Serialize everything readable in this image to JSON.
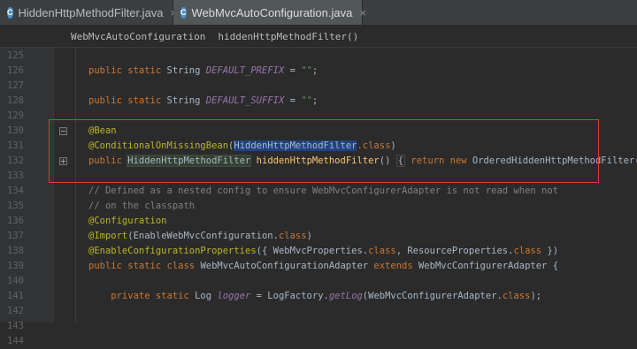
{
  "tabs": [
    {
      "icon": "C",
      "label": "HiddenHttpMethodFilter.java",
      "close": "×",
      "active": false
    },
    {
      "icon": "C",
      "label": "WebMvcAutoConfiguration.java",
      "close": "×",
      "active": true
    }
  ],
  "breadcrumb": {
    "class_name": "WebMvcAutoConfiguration",
    "method_name": "hiddenHttpMethodFilter()"
  },
  "lines": [
    {
      "n": "125",
      "parts": []
    },
    {
      "n": "126",
      "parts": [
        [
          "kw",
          "public static "
        ],
        [
          "cls",
          "String "
        ],
        [
          "const",
          "DEFAULT_PREFIX"
        ],
        [
          "cls",
          " = "
        ],
        [
          "str",
          "\"\""
        ],
        [
          "cls",
          ";"
        ]
      ]
    },
    {
      "n": "127",
      "parts": []
    },
    {
      "n": "128",
      "parts": [
        [
          "kw",
          "public static "
        ],
        [
          "cls",
          "String "
        ],
        [
          "const",
          "DEFAULT_SUFFIX"
        ],
        [
          "cls",
          " = "
        ],
        [
          "str",
          "\"\""
        ],
        [
          "cls",
          ";"
        ]
      ]
    },
    {
      "n": "129",
      "parts": []
    },
    {
      "n": "130",
      "parts": [
        [
          "ann",
          "@Bean"
        ]
      ]
    },
    {
      "n": "131",
      "parts": [
        [
          "ann",
          "@ConditionalOnMissingBean"
        ],
        [
          "cls",
          "("
        ],
        [
          "hl-sel",
          "HiddenHttpMethodFilter"
        ],
        [
          "kw",
          "."
        ],
        [
          "kw",
          "class"
        ],
        [
          "cls",
          ")"
        ]
      ]
    },
    {
      "n": "132",
      "parts": [
        [
          "kw",
          "public "
        ],
        [
          "hl-box",
          "HiddenHttpMethodFilter"
        ],
        [
          "cls",
          " "
        ],
        [
          "fn",
          "hiddenHttpMethodFilter"
        ],
        [
          "cls",
          "() "
        ],
        [
          "fold-inline",
          "{"
        ],
        [
          "kw",
          " return new "
        ],
        [
          "cls",
          "OrderedHiddenHttpMethodFilter(); "
        ],
        [
          "fold-inline",
          "}"
        ]
      ]
    },
    {
      "n": "133",
      "parts": []
    },
    {
      "n": "134",
      "parts": [
        [
          "cmt",
          "// Defined as a nested config to ensure WebMvcConfigurerAdapter is not read when not"
        ]
      ]
    },
    {
      "n": "135",
      "parts": [
        [
          "cmt",
          "// on the classpath"
        ]
      ]
    },
    {
      "n": "136",
      "parts": [
        [
          "ann",
          "@Configuration"
        ]
      ]
    },
    {
      "n": "137",
      "parts": [
        [
          "ann",
          "@Import"
        ],
        [
          "cls",
          "(EnableWebMvcConfiguration."
        ],
        [
          "kw",
          "class"
        ],
        [
          "cls",
          ")"
        ]
      ]
    },
    {
      "n": "138",
      "parts": [
        [
          "ann",
          "@EnableConfigurationProperties"
        ],
        [
          "cls",
          "({ WebMvcProperties."
        ],
        [
          "kw",
          "class"
        ],
        [
          "cls",
          ", ResourceProperties."
        ],
        [
          "kw",
          "class"
        ],
        [
          "cls",
          " })"
        ]
      ]
    },
    {
      "n": "139",
      "parts": [
        [
          "kw",
          "public static class "
        ],
        [
          "cls",
          "WebMvcAutoConfigurationAdapter "
        ],
        [
          "kw",
          "extends "
        ],
        [
          "cls",
          "WebMvcConfigurerAdapter {"
        ]
      ]
    },
    {
      "n": "140",
      "parts": []
    },
    {
      "n": "141",
      "parts": [
        [
          "kw",
          "    private static "
        ],
        [
          "cls",
          "Log "
        ],
        [
          "const",
          "logger"
        ],
        [
          "cls",
          " = LogFactory."
        ],
        [
          "const",
          "getLog"
        ],
        [
          "cls",
          "(WebMvcConfigurerAdapter."
        ],
        [
          "kw",
          "class"
        ],
        [
          "cls",
          ");"
        ]
      ]
    },
    {
      "n": "142",
      "parts": []
    },
    {
      "n": "143",
      "parts": []
    },
    {
      "n": "144",
      "parts": []
    }
  ]
}
